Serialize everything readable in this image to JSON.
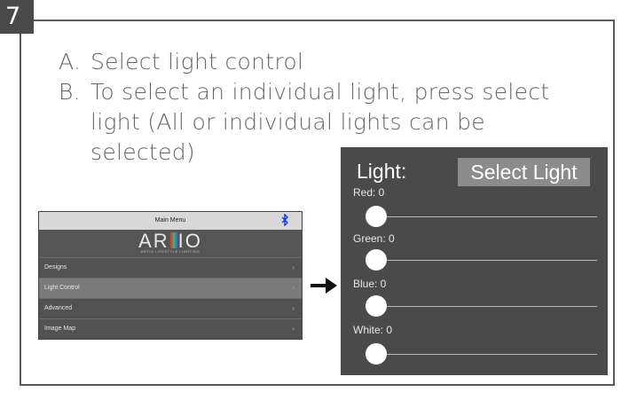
{
  "step": {
    "number": "7"
  },
  "instructions": {
    "a_marker": "A.",
    "a_text": "Select light control",
    "b_marker": "B.",
    "b_text_line1": "To select an individual light, press select",
    "b_text_line2": "light (All or individual lights can be",
    "b_text_line3": "selected)"
  },
  "main_menu": {
    "title": "Main Menu",
    "bluetooth_icon": "bluetooth-icon",
    "logo_left": "AR",
    "logo_right": "IO",
    "tagline": "ARTIO LIFESTYLE LIGHTING",
    "items": [
      {
        "label": "Designs",
        "selected": false
      },
      {
        "label": "Light Control",
        "selected": true
      },
      {
        "label": "Advanced",
        "selected": false
      },
      {
        "label": "Image Map",
        "selected": false
      }
    ],
    "chevron": "›"
  },
  "arrow_icon": "right-arrow-icon",
  "light_panel": {
    "title": "Light:",
    "select_button": "Select Light",
    "sliders": [
      {
        "label": "Red: 0",
        "value": 0
      },
      {
        "label": "Green: 0",
        "value": 0
      },
      {
        "label": "Blue: 0",
        "value": 0
      },
      {
        "label": "White: 0",
        "value": 0
      }
    ]
  },
  "colors": {
    "panel_bg": "#4a4a4a",
    "menu_bg": "#525252",
    "selected_item_bg": "#7a7a7a",
    "bluetooth": "#1b36e0",
    "instruction_text": "#666666"
  }
}
